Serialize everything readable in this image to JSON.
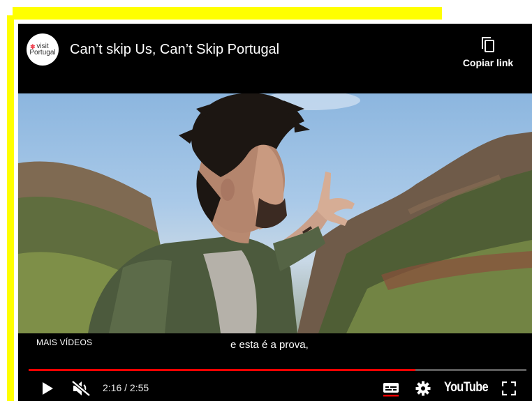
{
  "video": {
    "title": "Can’t skip Us, Can’t Skip Portugal",
    "channel_logo_text": "visit Portugal",
    "copy_link_label": "Copiar link",
    "more_videos_label": "MAIS VÍDEOS",
    "caption": "e esta é a prova,",
    "time_display": "2:16 / 2:55",
    "progress_fraction": 0.777,
    "youtube_logo_text": "YouTube"
  },
  "icons": {
    "copy": "copy-icon",
    "play": "play-icon",
    "mute": "volume-muted-icon",
    "subtitles": "subtitles-icon",
    "settings": "gear-icon",
    "fullscreen": "fullscreen-icon"
  },
  "colors": {
    "frame": "#ffff00",
    "progress": "#ff0000",
    "player_bg": "#000000"
  }
}
